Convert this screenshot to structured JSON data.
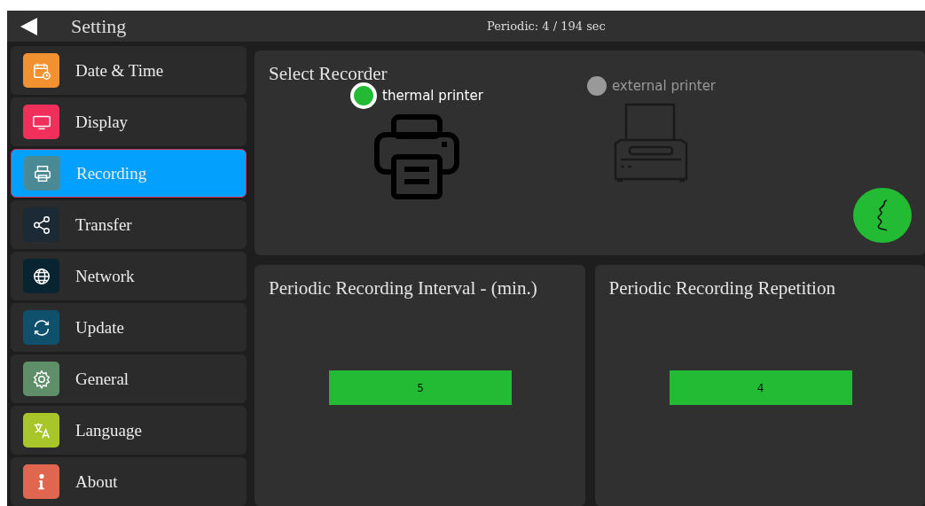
{
  "header": {
    "title": "Setting",
    "status": "Periodic: 4 / 194 sec"
  },
  "sidebar": {
    "items": [
      {
        "label": "Date & Time",
        "selected": false,
        "color": "#f29130"
      },
      {
        "label": "Display",
        "selected": false,
        "color": "#f02f5a"
      },
      {
        "label": "Recording",
        "selected": true,
        "color": "#4a8a95"
      },
      {
        "label": "Transfer",
        "selected": false,
        "color": "#1c2a36"
      },
      {
        "label": "Network",
        "selected": false,
        "color": "#082430"
      },
      {
        "label": "Update",
        "selected": false,
        "color": "#0f506c"
      },
      {
        "label": "General",
        "selected": false,
        "color": "#5f8f68"
      },
      {
        "label": "Language",
        "selected": false,
        "color": "#a8c62a"
      },
      {
        "label": "About",
        "selected": false,
        "color": "#e06650"
      }
    ]
  },
  "recorder": {
    "title": "Select Recorder",
    "options": [
      {
        "label": "thermal printer",
        "selected": true
      },
      {
        "label": "external printer",
        "selected": false
      }
    ]
  },
  "panels": [
    {
      "title": "Periodic Recording Interval - (min.)",
      "value": "5"
    },
    {
      "title": "Periodic Recording Repetition",
      "value": "4"
    }
  ]
}
